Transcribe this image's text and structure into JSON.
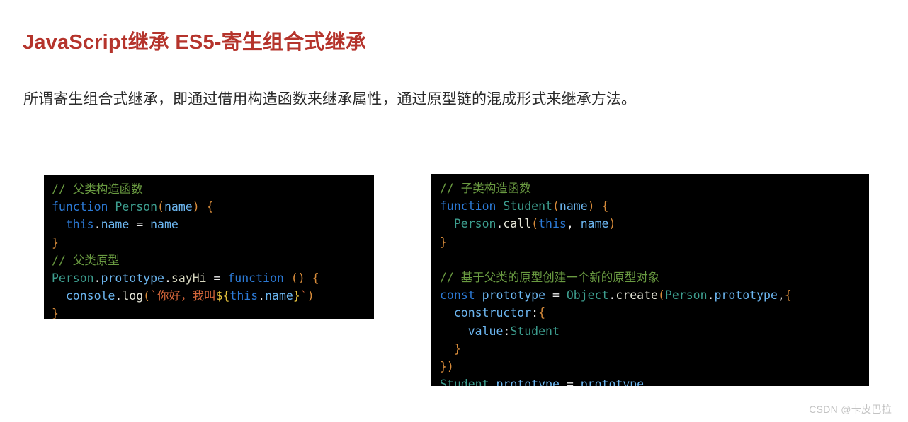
{
  "page": {
    "title": "JavaScript继承 ES5-寄生组合式继承",
    "intro": "所谓寄生组合式继承，即通过借用构造函数来继承属性，通过原型链的混成形式来继承方法。",
    "watermark": "CSDN @卡皮巴拉",
    "title_color": "#b5342c",
    "code_background": "#000000"
  },
  "code_blocks": {
    "left": {
      "name": "parent-class-code",
      "plain_text": "// 父类构造函数\nfunction Person(name) {\n  this.name = name\n}\n// 父类原型\nPerson.prototype.sayHi = function () {\n  console.log(`你好，我叫${this.name}`)\n}",
      "lines": [
        {
          "tokens": [
            {
              "t": "// 父类构造函数",
              "c": "tk-comment"
            }
          ]
        },
        {
          "tokens": [
            {
              "t": "function",
              "c": "tk-keyword"
            },
            {
              "t": " ",
              "c": "tk-plain"
            },
            {
              "t": "Person",
              "c": "tk-type"
            },
            {
              "t": "(",
              "c": "tk-punct"
            },
            {
              "t": "name",
              "c": "tk-prop"
            },
            {
              "t": ")",
              "c": "tk-punct"
            },
            {
              "t": " ",
              "c": "tk-plain"
            },
            {
              "t": "{",
              "c": "tk-punct"
            }
          ]
        },
        {
          "tokens": [
            {
              "t": "  ",
              "c": "tk-plain"
            },
            {
              "t": "this",
              "c": "tk-keyword"
            },
            {
              "t": ".",
              "c": "tk-plain"
            },
            {
              "t": "name",
              "c": "tk-prop"
            },
            {
              "t": " ",
              "c": "tk-plain"
            },
            {
              "t": "=",
              "c": "tk-plain"
            },
            {
              "t": " ",
              "c": "tk-plain"
            },
            {
              "t": "name",
              "c": "tk-prop"
            }
          ]
        },
        {
          "tokens": [
            {
              "t": "}",
              "c": "tk-punct"
            }
          ]
        },
        {
          "tokens": [
            {
              "t": "// 父类原型",
              "c": "tk-comment"
            }
          ]
        },
        {
          "tokens": [
            {
              "t": "Person",
              "c": "tk-type"
            },
            {
              "t": ".",
              "c": "tk-plain"
            },
            {
              "t": "prototype",
              "c": "tk-prop"
            },
            {
              "t": ".",
              "c": "tk-plain"
            },
            {
              "t": "sayHi",
              "c": "tk-func"
            },
            {
              "t": " ",
              "c": "tk-plain"
            },
            {
              "t": "=",
              "c": "tk-plain"
            },
            {
              "t": " ",
              "c": "tk-plain"
            },
            {
              "t": "function",
              "c": "tk-keyword"
            },
            {
              "t": " ",
              "c": "tk-plain"
            },
            {
              "t": "()",
              "c": "tk-punct"
            },
            {
              "t": " ",
              "c": "tk-plain"
            },
            {
              "t": "{",
              "c": "tk-punct"
            }
          ]
        },
        {
          "tokens": [
            {
              "t": "  ",
              "c": "tk-plain"
            },
            {
              "t": "console",
              "c": "tk-prop"
            },
            {
              "t": ".",
              "c": "tk-plain"
            },
            {
              "t": "log",
              "c": "tk-method"
            },
            {
              "t": "(",
              "c": "tk-punct"
            },
            {
              "t": "`你好，我叫",
              "c": "tk-string"
            },
            {
              "t": "${",
              "c": "tk-interp"
            },
            {
              "t": "this",
              "c": "tk-keyword"
            },
            {
              "t": ".",
              "c": "tk-plain"
            },
            {
              "t": "name",
              "c": "tk-prop"
            },
            {
              "t": "}",
              "c": "tk-interp"
            },
            {
              "t": "`",
              "c": "tk-string"
            },
            {
              "t": ")",
              "c": "tk-punct"
            }
          ]
        },
        {
          "tokens": [
            {
              "t": "}",
              "c": "tk-punct"
            }
          ]
        }
      ]
    },
    "right": {
      "name": "child-class-code",
      "plain_text": "// 子类构造函数\nfunction Student(name) {\n  Person.call(this, name)\n}\n\n// 基于父类的原型创建一个新的原型对象\nconst prototype = Object.create(Person.prototype,{\n  constructor:{\n    value:Student\n  }\n})\nStudent.prototype = prototype",
      "lines": [
        {
          "tokens": [
            {
              "t": "// 子类构造函数",
              "c": "tk-comment"
            }
          ]
        },
        {
          "tokens": [
            {
              "t": "function",
              "c": "tk-keyword"
            },
            {
              "t": " ",
              "c": "tk-plain"
            },
            {
              "t": "Student",
              "c": "tk-type"
            },
            {
              "t": "(",
              "c": "tk-punct"
            },
            {
              "t": "name",
              "c": "tk-prop"
            },
            {
              "t": ")",
              "c": "tk-punct"
            },
            {
              "t": " ",
              "c": "tk-plain"
            },
            {
              "t": "{",
              "c": "tk-punct"
            }
          ]
        },
        {
          "tokens": [
            {
              "t": "  ",
              "c": "tk-plain"
            },
            {
              "t": "Person",
              "c": "tk-type"
            },
            {
              "t": ".",
              "c": "tk-plain"
            },
            {
              "t": "call",
              "c": "tk-method"
            },
            {
              "t": "(",
              "c": "tk-punct"
            },
            {
              "t": "this",
              "c": "tk-keyword"
            },
            {
              "t": ",",
              "c": "tk-plain"
            },
            {
              "t": " ",
              "c": "tk-plain"
            },
            {
              "t": "name",
              "c": "tk-prop"
            },
            {
              "t": ")",
              "c": "tk-punct"
            }
          ]
        },
        {
          "tokens": [
            {
              "t": "}",
              "c": "tk-punct"
            }
          ]
        },
        {
          "tokens": [
            {
              "t": " ",
              "c": "tk-plain"
            }
          ]
        },
        {
          "tokens": [
            {
              "t": "// 基于父类的原型创建一个新的原型对象",
              "c": "tk-comment"
            }
          ]
        },
        {
          "tokens": [
            {
              "t": "const",
              "c": "tk-keyword"
            },
            {
              "t": " ",
              "c": "tk-plain"
            },
            {
              "t": "prototype",
              "c": "tk-prop"
            },
            {
              "t": " ",
              "c": "tk-plain"
            },
            {
              "t": "=",
              "c": "tk-plain"
            },
            {
              "t": " ",
              "c": "tk-plain"
            },
            {
              "t": "Object",
              "c": "tk-type"
            },
            {
              "t": ".",
              "c": "tk-plain"
            },
            {
              "t": "create",
              "c": "tk-method"
            },
            {
              "t": "(",
              "c": "tk-punct"
            },
            {
              "t": "Person",
              "c": "tk-type"
            },
            {
              "t": ".",
              "c": "tk-plain"
            },
            {
              "t": "prototype",
              "c": "tk-prop"
            },
            {
              "t": ",",
              "c": "tk-plain"
            },
            {
              "t": "{",
              "c": "tk-punct"
            }
          ]
        },
        {
          "tokens": [
            {
              "t": "  ",
              "c": "tk-plain"
            },
            {
              "t": "constructor",
              "c": "tk-prop"
            },
            {
              "t": ":",
              "c": "tk-plain"
            },
            {
              "t": "{",
              "c": "tk-punct"
            }
          ]
        },
        {
          "tokens": [
            {
              "t": "    ",
              "c": "tk-plain"
            },
            {
              "t": "value",
              "c": "tk-prop"
            },
            {
              "t": ":",
              "c": "tk-plain"
            },
            {
              "t": "Student",
              "c": "tk-type"
            }
          ]
        },
        {
          "tokens": [
            {
              "t": "  ",
              "c": "tk-plain"
            },
            {
              "t": "}",
              "c": "tk-punct"
            }
          ]
        },
        {
          "tokens": [
            {
              "t": "})",
              "c": "tk-punct"
            }
          ]
        },
        {
          "tokens": [
            {
              "t": "Student",
              "c": "tk-type"
            },
            {
              "t": ".",
              "c": "tk-plain"
            },
            {
              "t": "prototype",
              "c": "tk-prop"
            },
            {
              "t": " ",
              "c": "tk-plain"
            },
            {
              "t": "=",
              "c": "tk-plain"
            },
            {
              "t": " ",
              "c": "tk-plain"
            },
            {
              "t": "prototype",
              "c": "tk-prop"
            }
          ]
        }
      ]
    }
  }
}
